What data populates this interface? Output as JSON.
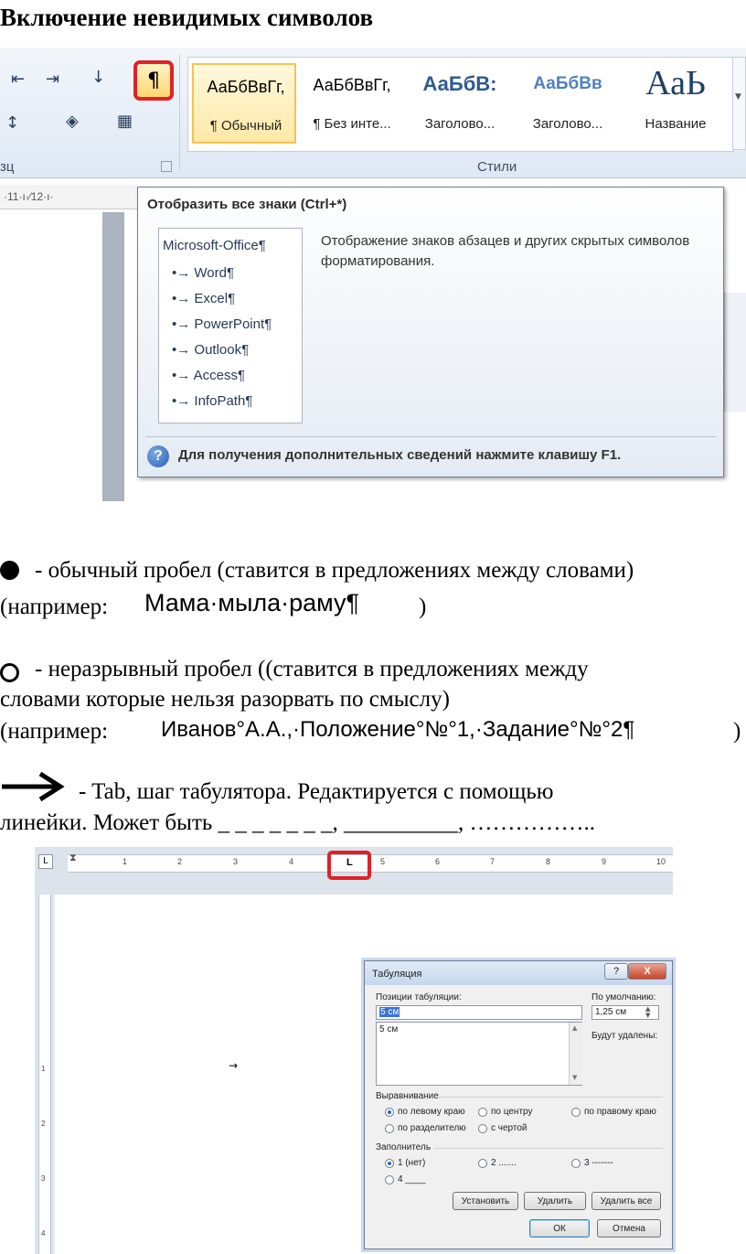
{
  "heading": "Включение невидимых символов",
  "ribbon": {
    "group_paragraph_label": "зц",
    "group_styles_label": "Стили",
    "pilcrow_symbol": "¶",
    "ruler_text": "·11·ı·⁄12·ı·",
    "styles": [
      {
        "sample": "АаБбВвГг,",
        "name": "¶ Обычный",
        "selected": true
      },
      {
        "sample": "АаБбВвГг,",
        "name": "¶ Без инте...",
        "selected": false
      },
      {
        "sample": "АаБбВ:",
        "name": "Заголово...",
        "selected": false
      },
      {
        "sample": "АаБбВв",
        "name": "Заголово...",
        "selected": false
      },
      {
        "sample": "АаЬ",
        "name": "Название",
        "selected": false
      }
    ],
    "accent_color": "#e0212a"
  },
  "tooltip": {
    "title": "Отобразить все знаки (Ctrl+*)",
    "preview_header": "Microsoft-Office¶",
    "preview_items": [
      "•→ Word¶",
      "•→ Excel¶",
      "•→ PowerPoint¶",
      "•→ Outlook¶",
      "•→ Access¶",
      "•→ InfoPath¶"
    ],
    "description": "Отображение знаков абзацев и других скрытых символов форматирования.",
    "help_symbol": "?",
    "help_text": "Для получения дополнительных сведений нажмите клавишу F1."
  },
  "regular_space": {
    "line1": "- обычный пробел (ставится в предложениях между словами)",
    "example_prefix": "(например:",
    "example_sample": "Мама·мыла·раму¶",
    "example_suffix": ")"
  },
  "nonbreaking_space": {
    "line1": "- неразрывный пробел ((ставится в предложениях между",
    "line2": "словами которые нельзя разорвать по смыслу)",
    "example_prefix": "(например:",
    "example_sample": "Иванов°А.А.,·Положение°№°1,·Задание°№°2¶",
    "example_suffix": ")"
  },
  "tab": {
    "line1": "- Tab, шаг табулятора. Редактируется с помощью",
    "line2": "линейки. Может быть _ _ _ _ _ _ _, __________, ……………..",
    "arrow_symbol": "→",
    "paragraph_mark": "¶"
  },
  "ruler": {
    "numbers": [
      "1",
      "2",
      "3",
      "4",
      "5",
      "6",
      "7",
      "8",
      "9",
      "10"
    ],
    "tab_glyph": "L",
    "corner_glyph": "L"
  },
  "vruler_numbers": [
    "1",
    "2",
    "3",
    "4"
  ],
  "dialog": {
    "title": "Табуляция",
    "help_button": "?",
    "close_button": "X",
    "positions_label": "Позиции табуляции:",
    "positions_value": "5 см",
    "positions_list": [
      "5 см"
    ],
    "default_label": "По умолчанию:",
    "default_value": "1,25 см",
    "removed_label": "Будут удалены:",
    "alignment_label": "Выравнивание",
    "align_left": "по левому краю",
    "align_center": "по центру",
    "align_right": "по правому краю",
    "align_decimal": "по разделителю",
    "align_bar": "с чертой",
    "leader_label": "Заполнитель",
    "leader_1": "1 (нет)",
    "leader_2": "2 .......",
    "leader_3": "3 -------",
    "leader_4": "4 ____",
    "btn_set": "Установить",
    "btn_clear": "Удалить",
    "btn_clear_all": "Удалить все",
    "btn_ok": "ОК",
    "btn_cancel": "Отмена"
  }
}
